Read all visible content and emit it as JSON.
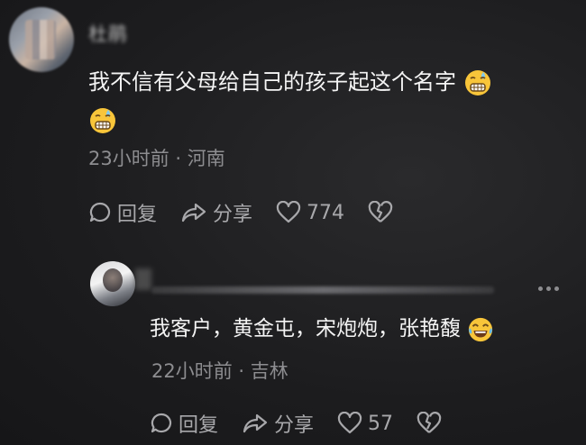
{
  "comment": {
    "username": "杜鹃",
    "text": "我不信有父母给自己的孩子起这个名字",
    "emoji_icon": "grimacing-sweat-emoji",
    "meta": "23小时前 · 河南",
    "actions": {
      "reply_label": "回复",
      "share_label": "分享",
      "like_count": "774"
    }
  },
  "reply": {
    "text": "我客户，黄金屯，宋炮炮，张艳馥",
    "emoji_icon": "tears-of-joy-emoji",
    "meta": "22小时前 · 吉林",
    "actions": {
      "reply_label": "回复",
      "share_label": "分享",
      "like_count": "57"
    }
  },
  "colors": {
    "background": "#1c1c1e",
    "text_primary": "#f4f4f4",
    "text_secondary": "#8d8d90",
    "action_gray": "#a8a8ab"
  }
}
